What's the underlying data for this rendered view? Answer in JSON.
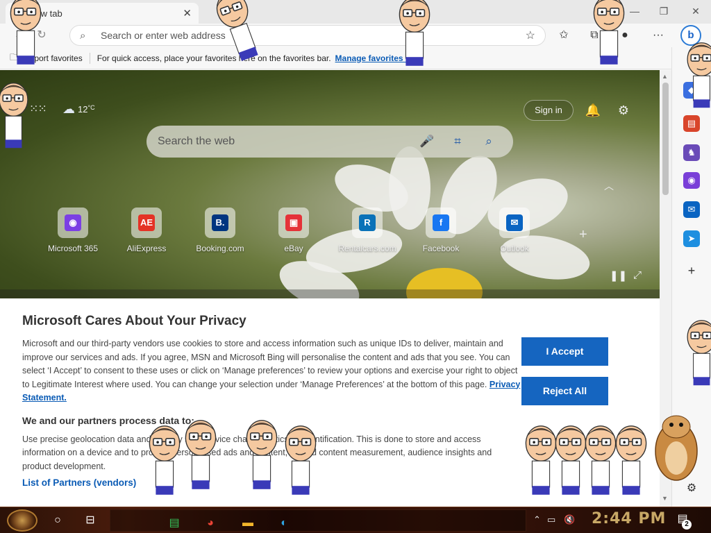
{
  "browser": {
    "tab": {
      "title": "New tab"
    },
    "window_controls": {
      "minimize": "—",
      "restore": "❐",
      "close": "✕"
    },
    "address_bar": {
      "placeholder": "Search or enter web address",
      "value": ""
    },
    "favorites_bar": {
      "import_label": "Import favorites",
      "message": "For quick access, place your favorites here on the favorites bar.",
      "manage_link": "Manage favorites now"
    }
  },
  "new_tab_page": {
    "weather": {
      "temperature": "12",
      "unit": "°C"
    },
    "sign_in_label": "Sign in",
    "search": {
      "placeholder": "Search the web"
    },
    "quick_links": [
      {
        "label": "Microsoft 365",
        "glyph": "◉",
        "color": "#7b3fe4"
      },
      {
        "label": "AliExpress",
        "glyph": "AE",
        "color": "#e43225"
      },
      {
        "label": "Booking.com",
        "glyph": "B.",
        "color": "#003580"
      },
      {
        "label": "eBay",
        "glyph": "▣",
        "color": "#e53238"
      },
      {
        "label": "Rentalcars.com",
        "glyph": "R",
        "color": "#0a72b8"
      },
      {
        "label": "Facebook",
        "glyph": "f",
        "color": "#1877f2"
      },
      {
        "label": "Outlook",
        "glyph": "✉",
        "color": "#0a64c2"
      }
    ]
  },
  "privacy_notice": {
    "title": "Microsoft Cares About Your Privacy",
    "body": "Microsoft and our third-party vendors use cookies to store and access information such as unique IDs to deliver, maintain and improve our services and ads. If you agree, MSN and Microsoft Bing will personalise the content and ads that you see. You can select ‘I Accept’ to consent to these uses or click on ‘Manage preferences’ to review your options and exercise your right to object to Legitimate Interest where used. You can change your selection under ‘Manage Preferences’ at the bottom of this page.",
    "privacy_link": "Privacy Statement.",
    "subheading": "We and our partners process data to:",
    "body2": "Use precise geolocation data and actively scan device characteristics for identification. This is done to store and access information on a device and to provide personalised ads and content, ad and content measurement, audience insights and product development.",
    "partners_link": "List of Partners (vendors)",
    "accept_label": "I Accept",
    "reject_label": "Reject All"
  },
  "taskbar": {
    "clock": "2:44 PM",
    "notification_count": "2"
  },
  "icons": {
    "accent": "#1565c0",
    "link": "#0a5bb5"
  }
}
